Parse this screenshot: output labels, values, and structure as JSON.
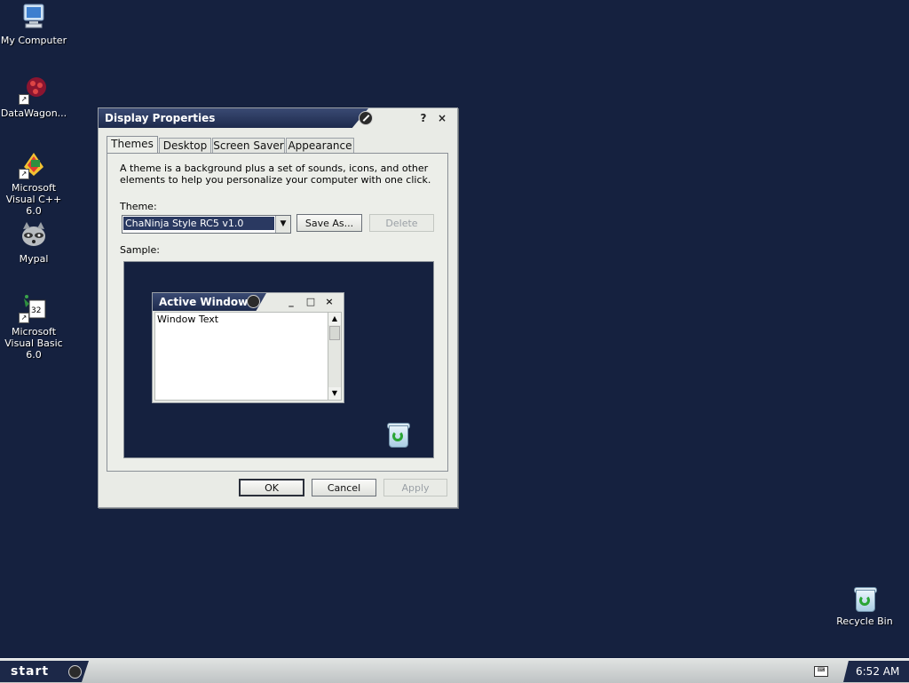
{
  "desktop": {
    "icons": [
      {
        "label": "My Computer"
      },
      {
        "label": "DataWagon..."
      },
      {
        "label": "Microsoft Visual C++ 6.0"
      },
      {
        "label": "Mypal"
      },
      {
        "label": "Microsoft Visual Basic 6.0"
      },
      {
        "label": "Recycle Bin"
      }
    ]
  },
  "dialog": {
    "title": "Display Properties",
    "help_label": "?",
    "close_label": "×",
    "tabs": [
      {
        "label": "Themes",
        "active": true
      },
      {
        "label": "Desktop"
      },
      {
        "label": "Screen Saver"
      },
      {
        "label": "Appearance"
      }
    ],
    "description": "A theme is a background plus a set of sounds, icons, and other elements to help you personalize your computer with one click.",
    "theme_label": "Theme:",
    "theme_value": "ChaNinja Style RC5 v1.0",
    "save_as_label": "Save As...",
    "delete_label": "Delete",
    "sample_label": "Sample:",
    "sample": {
      "window_title": "Active Window",
      "window_text": "Window Text"
    },
    "ok_label": "OK",
    "cancel_label": "Cancel",
    "apply_label": "Apply"
  },
  "taskbar": {
    "start_label": "start",
    "clock": "6:52 AM"
  },
  "colors": {
    "desktop_bg": "#15213f",
    "title_bar": "#1d2a4c",
    "selection": "#2a3961"
  }
}
